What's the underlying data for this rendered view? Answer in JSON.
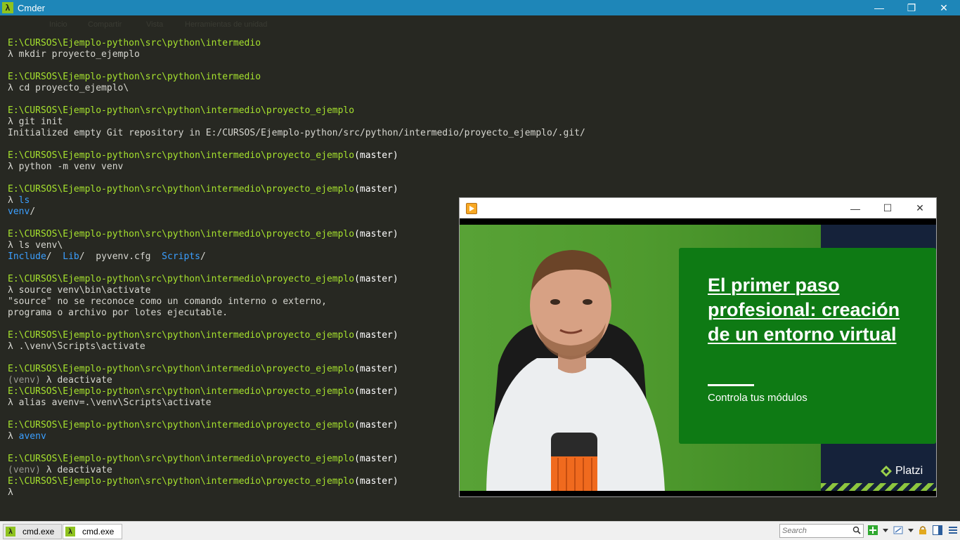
{
  "window": {
    "title": "Cmder",
    "app_icon_glyph": "λ",
    "minimize_glyph": "—",
    "restore_glyph": "❐",
    "close_glyph": "✕"
  },
  "ghost_bar": {
    "items": [
      "Inicio",
      "Compartir",
      "Vista",
      "Herramientas de unidad"
    ]
  },
  "terminal": {
    "lines": [
      [
        {
          "t": "E:\\CURSOS\\Ejemplo-python\\src\\python\\intermedio",
          "c": "path"
        }
      ],
      [
        {
          "t": "λ ",
          "c": "lambda"
        },
        {
          "t": "mkdir proyecto_ejemplo",
          "c": "cmd"
        }
      ],
      [],
      [
        {
          "t": "E:\\CURSOS\\Ejemplo-python\\src\\python\\intermedio",
          "c": "path"
        }
      ],
      [
        {
          "t": "λ ",
          "c": "lambda"
        },
        {
          "t": "cd proyecto_ejemplo\\",
          "c": "cmd"
        }
      ],
      [],
      [
        {
          "t": "E:\\CURSOS\\Ejemplo-python\\src\\python\\intermedio\\proyecto_ejemplo",
          "c": "path"
        }
      ],
      [
        {
          "t": "λ ",
          "c": "lambda"
        },
        {
          "t": "git init",
          "c": "cmd"
        }
      ],
      [
        {
          "t": "Initialized empty Git repository in E:/CURSOS/Ejemplo-python/src/python/intermedio/proyecto_ejemplo/.git/",
          "c": "out"
        }
      ],
      [],
      [
        {
          "t": "E:\\CURSOS\\Ejemplo-python\\src\\python\\intermedio\\proyecto_ejemplo",
          "c": "path"
        },
        {
          "t": "(master)",
          "c": "branch"
        }
      ],
      [
        {
          "t": "λ ",
          "c": "lambda"
        },
        {
          "t": "python -m venv venv",
          "c": "cmd"
        }
      ],
      [],
      [
        {
          "t": "E:\\CURSOS\\Ejemplo-python\\src\\python\\intermedio\\proyecto_ejemplo",
          "c": "path"
        },
        {
          "t": "(master)",
          "c": "branch"
        }
      ],
      [
        {
          "t": "λ ",
          "c": "lambda"
        },
        {
          "t": "ls",
          "c": "dir"
        }
      ],
      [
        {
          "t": "venv",
          "c": "dir"
        },
        {
          "t": "/",
          "c": "out"
        }
      ],
      [],
      [
        {
          "t": "E:\\CURSOS\\Ejemplo-python\\src\\python\\intermedio\\proyecto_ejemplo",
          "c": "path"
        },
        {
          "t": "(master)",
          "c": "branch"
        }
      ],
      [
        {
          "t": "λ ",
          "c": "lambda"
        },
        {
          "t": "ls venv\\",
          "c": "cmd"
        }
      ],
      [
        {
          "t": "Include",
          "c": "dir"
        },
        {
          "t": "/  ",
          "c": "out"
        },
        {
          "t": "Lib",
          "c": "dir"
        },
        {
          "t": "/  pyvenv.cfg  ",
          "c": "out"
        },
        {
          "t": "Scripts",
          "c": "dir"
        },
        {
          "t": "/",
          "c": "out"
        }
      ],
      [],
      [
        {
          "t": "E:\\CURSOS\\Ejemplo-python\\src\\python\\intermedio\\proyecto_ejemplo",
          "c": "path"
        },
        {
          "t": "(master)",
          "c": "branch"
        }
      ],
      [
        {
          "t": "λ ",
          "c": "lambda"
        },
        {
          "t": "source venv\\bin\\activate",
          "c": "cmd"
        }
      ],
      [
        {
          "t": "\"source\" no se reconoce como un comando interno o externo,",
          "c": "out"
        }
      ],
      [
        {
          "t": "programa o archivo por lotes ejecutable.",
          "c": "out"
        }
      ],
      [],
      [
        {
          "t": "E:\\CURSOS\\Ejemplo-python\\src\\python\\intermedio\\proyecto_ejemplo",
          "c": "path"
        },
        {
          "t": "(master)",
          "c": "branch"
        }
      ],
      [
        {
          "t": "λ ",
          "c": "lambda"
        },
        {
          "t": ".\\venv\\Scripts\\activate",
          "c": "cmd"
        }
      ],
      [],
      [
        {
          "t": "E:\\CURSOS\\Ejemplo-python\\src\\python\\intermedio\\proyecto_ejemplo",
          "c": "path"
        },
        {
          "t": "(master)",
          "c": "branch"
        }
      ],
      [
        {
          "t": "(venv) ",
          "c": "venvtag"
        },
        {
          "t": "λ ",
          "c": "lambda"
        },
        {
          "t": "deactivate",
          "c": "cmd"
        }
      ],
      [
        {
          "t": "E:\\CURSOS\\Ejemplo-python\\src\\python\\intermedio\\proyecto_ejemplo",
          "c": "path"
        },
        {
          "t": "(master)",
          "c": "branch"
        }
      ],
      [
        {
          "t": "λ ",
          "c": "lambda"
        },
        {
          "t": "alias avenv=.\\venv\\Scripts\\activate",
          "c": "cmd"
        }
      ],
      [],
      [
        {
          "t": "E:\\CURSOS\\Ejemplo-python\\src\\python\\intermedio\\proyecto_ejemplo",
          "c": "path"
        },
        {
          "t": "(master)",
          "c": "branch"
        }
      ],
      [
        {
          "t": "λ ",
          "c": "lambda"
        },
        {
          "t": "avenv",
          "c": "dir"
        }
      ],
      [],
      [
        {
          "t": "E:\\CURSOS\\Ejemplo-python\\src\\python\\intermedio\\proyecto_ejemplo",
          "c": "path"
        },
        {
          "t": "(master)",
          "c": "branch"
        }
      ],
      [
        {
          "t": "(venv) ",
          "c": "venvtag"
        },
        {
          "t": "λ ",
          "c": "lambda"
        },
        {
          "t": "deactivate",
          "c": "cmd"
        }
      ],
      [
        {
          "t": "E:\\CURSOS\\Ejemplo-python\\src\\python\\intermedio\\proyecto_ejemplo",
          "c": "path"
        },
        {
          "t": "(master)",
          "c": "branch"
        }
      ],
      [
        {
          "t": "λ",
          "c": "lambda"
        }
      ]
    ]
  },
  "video_window": {
    "minimize_glyph": "—",
    "maximize_glyph": "☐",
    "close_glyph": "✕",
    "slide": {
      "title": "El primer paso profesional: creación de un entorno virtual",
      "subtitle": "Controla tus módulos",
      "brand": "Platzi"
    }
  },
  "statusbar": {
    "tabs": [
      {
        "label": "cmd.exe",
        "active": false
      },
      {
        "label": "cmd.exe",
        "active": true
      }
    ],
    "search_placeholder": "Search"
  },
  "colors": {
    "terminal_bg": "#272822",
    "prompt_path": "#a6e22e",
    "directory": "#3b9fff",
    "titlebar": "#1e86b8",
    "slide_green": "#0e7a14",
    "slide_navy": "#15223a"
  },
  "icons": [
    "lambda-icon",
    "minimize-icon",
    "restore-icon",
    "close-icon",
    "play-icon",
    "platzi-icon",
    "search-icon",
    "add-icon",
    "lock-icon",
    "layout-icon",
    "menu-icon"
  ]
}
